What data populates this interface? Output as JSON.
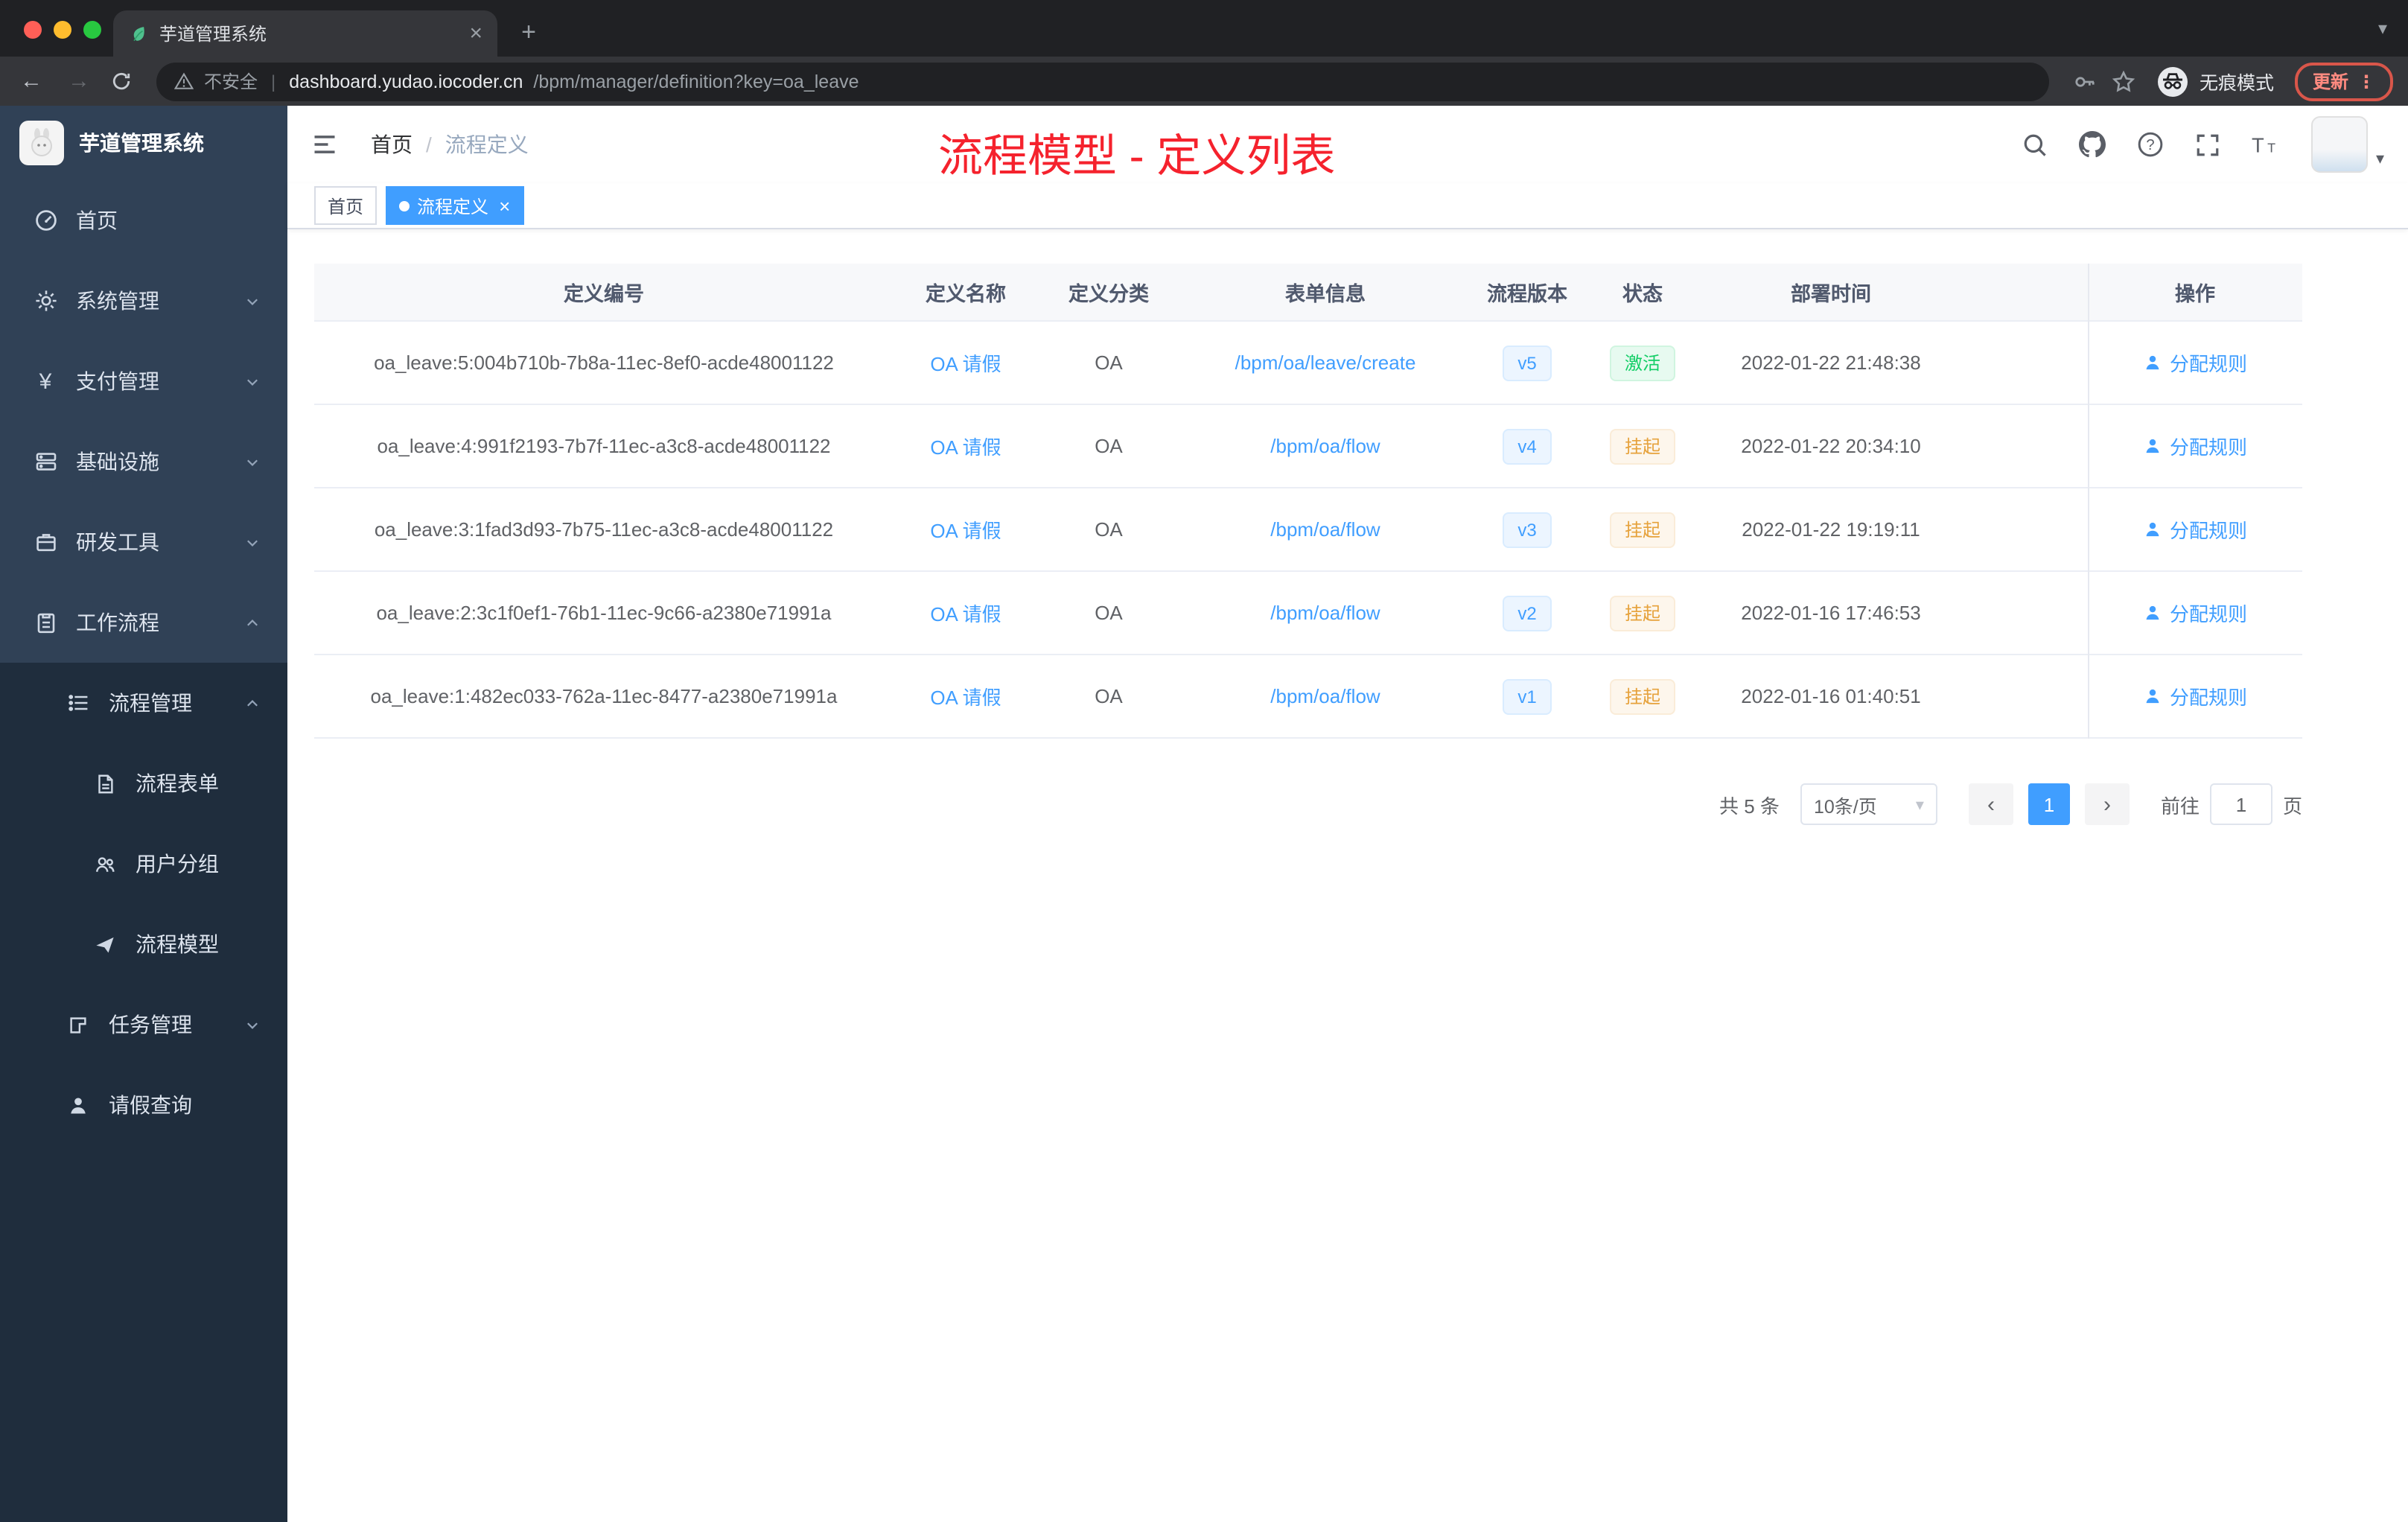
{
  "browser": {
    "tab_title": "芋道管理系统",
    "security_label": "不安全",
    "url_host": "dashboard.yudao.iocoder.cn",
    "url_path": "/bpm/manager/definition?key=oa_leave",
    "incognito_label": "无痕模式",
    "update_label": "更新"
  },
  "icons": {
    "close": "×",
    "plus": "+",
    "back": "←",
    "forward": "→",
    "more": "⋮",
    "caret_down": "▾",
    "prev": "‹",
    "next": "›",
    "yen": "¥",
    "pipe": "|"
  },
  "sidebar": {
    "app_title": "芋道管理系统",
    "items": [
      {
        "label": "首页"
      },
      {
        "label": "系统管理"
      },
      {
        "label": "支付管理"
      },
      {
        "label": "基础设施"
      },
      {
        "label": "研发工具"
      },
      {
        "label": "工作流程"
      },
      {
        "label": "流程管理"
      },
      {
        "label": "流程表单"
      },
      {
        "label": "用户分组"
      },
      {
        "label": "流程模型"
      },
      {
        "label": "任务管理"
      },
      {
        "label": "请假查询"
      }
    ]
  },
  "navbar": {
    "breadcrumb_home": "首页",
    "breadcrumb_sep": "/",
    "breadcrumb_current": "流程定义",
    "annotation": "流程模型 - 定义列表"
  },
  "tags": {
    "home": "首页",
    "active": "流程定义"
  },
  "table": {
    "columns": [
      "定义编号",
      "定义名称",
      "定义分类",
      "表单信息",
      "流程版本",
      "状态",
      "部署时间",
      "操作"
    ],
    "rows": [
      {
        "id": "oa_leave:5:004b710b-7b8a-11ec-8ef0-acde48001122",
        "name": "OA 请假",
        "category": "OA",
        "form": "/bpm/oa/leave/create",
        "version": "v5",
        "status": "激活",
        "time": "2022-01-22 21:48:38",
        "action": "分配规则"
      },
      {
        "id": "oa_leave:4:991f2193-7b7f-11ec-a3c8-acde48001122",
        "name": "OA 请假",
        "category": "OA",
        "form": "/bpm/oa/flow",
        "version": "v4",
        "status": "挂起",
        "time": "2022-01-22 20:34:10",
        "action": "分配规则"
      },
      {
        "id": "oa_leave:3:1fad3d93-7b75-11ec-a3c8-acde48001122",
        "name": "OA 请假",
        "category": "OA",
        "form": "/bpm/oa/flow",
        "version": "v3",
        "status": "挂起",
        "time": "2022-01-22 19:19:11",
        "action": "分配规则"
      },
      {
        "id": "oa_leave:2:3c1f0ef1-76b1-11ec-9c66-a2380e71991a",
        "name": "OA 请假",
        "category": "OA",
        "form": "/bpm/oa/flow",
        "version": "v2",
        "status": "挂起",
        "time": "2022-01-16 17:46:53",
        "action": "分配规则"
      },
      {
        "id": "oa_leave:1:482ec033-762a-11ec-8477-a2380e71991a",
        "name": "OA 请假",
        "category": "OA",
        "form": "/bpm/oa/flow",
        "version": "v1",
        "status": "挂起",
        "time": "2022-01-16 01:40:51",
        "action": "分配规则"
      }
    ]
  },
  "pagination": {
    "total": "共 5 条",
    "page_size": "10条/页",
    "current_page": "1",
    "goto_prefix": "前往",
    "goto_suffix": "页",
    "goto_value": "1"
  },
  "colors": {
    "accent": "#409eff",
    "annotation_red": "#f5222d",
    "sidebar_bg": "#304156",
    "submenu_bg": "#1f2d3d",
    "success_text": "#13ce66",
    "warning_text": "#e6a23c"
  }
}
